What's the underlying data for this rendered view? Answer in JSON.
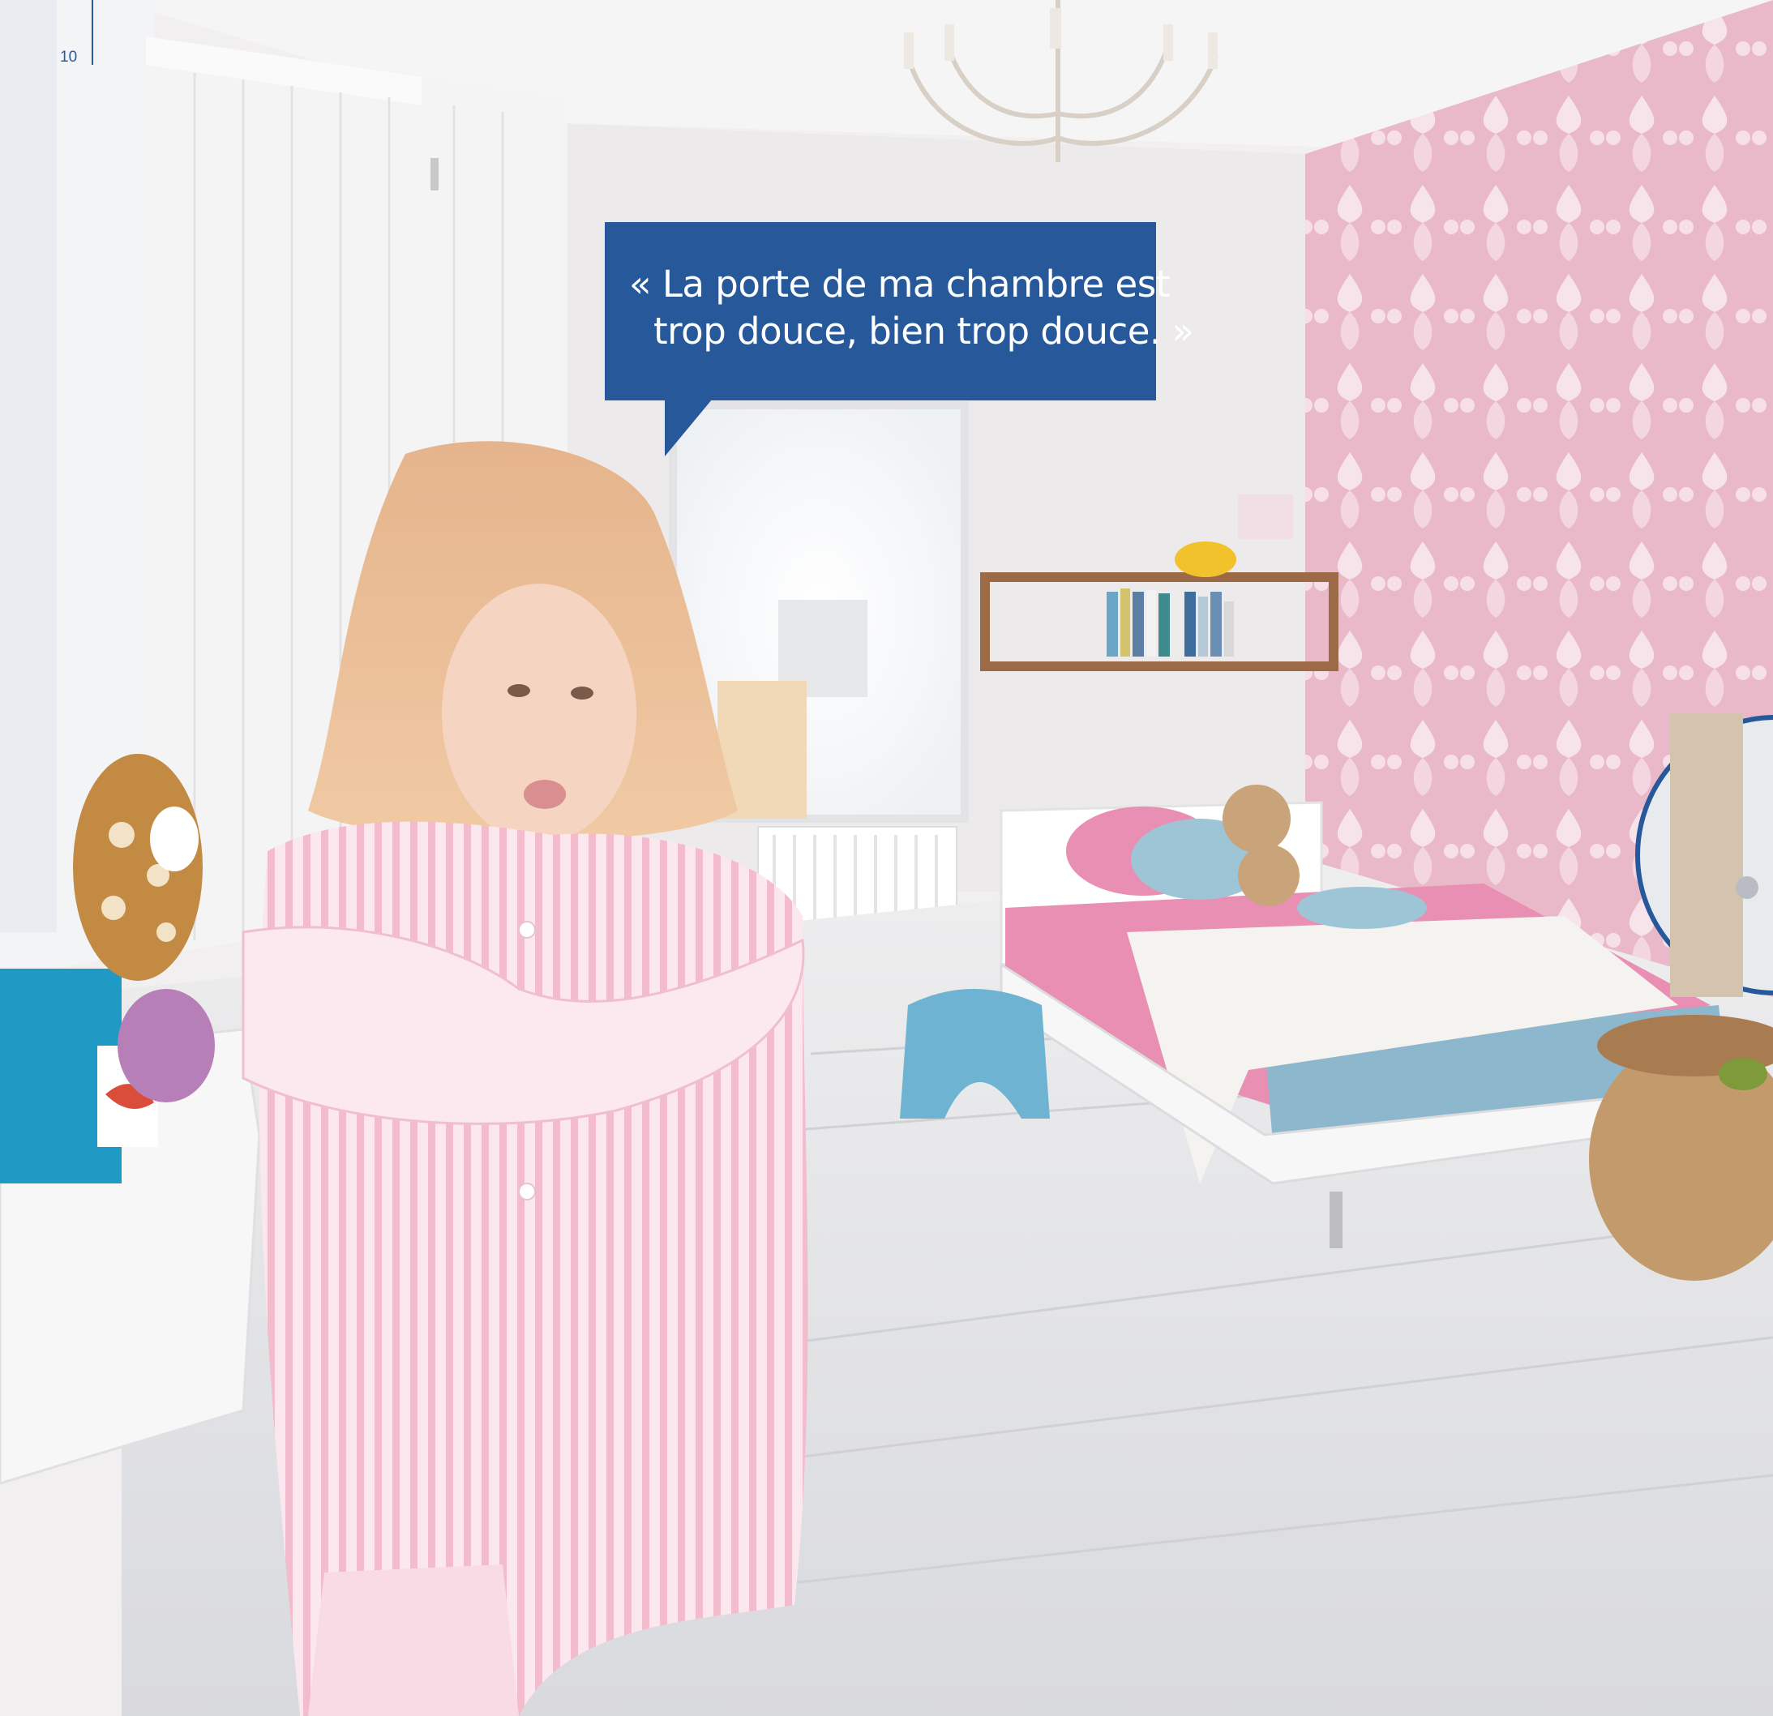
{
  "page": {
    "number": "10"
  },
  "quote": {
    "line1": "« La porte de ma chambre est",
    "line2": "trop douce, bien trop douce. »"
  },
  "colors": {
    "accent": "#26589a",
    "wallpaper": "#e9b9c9",
    "bed_pink": "#e88fb3",
    "bed_blue": "#8db7cc"
  }
}
